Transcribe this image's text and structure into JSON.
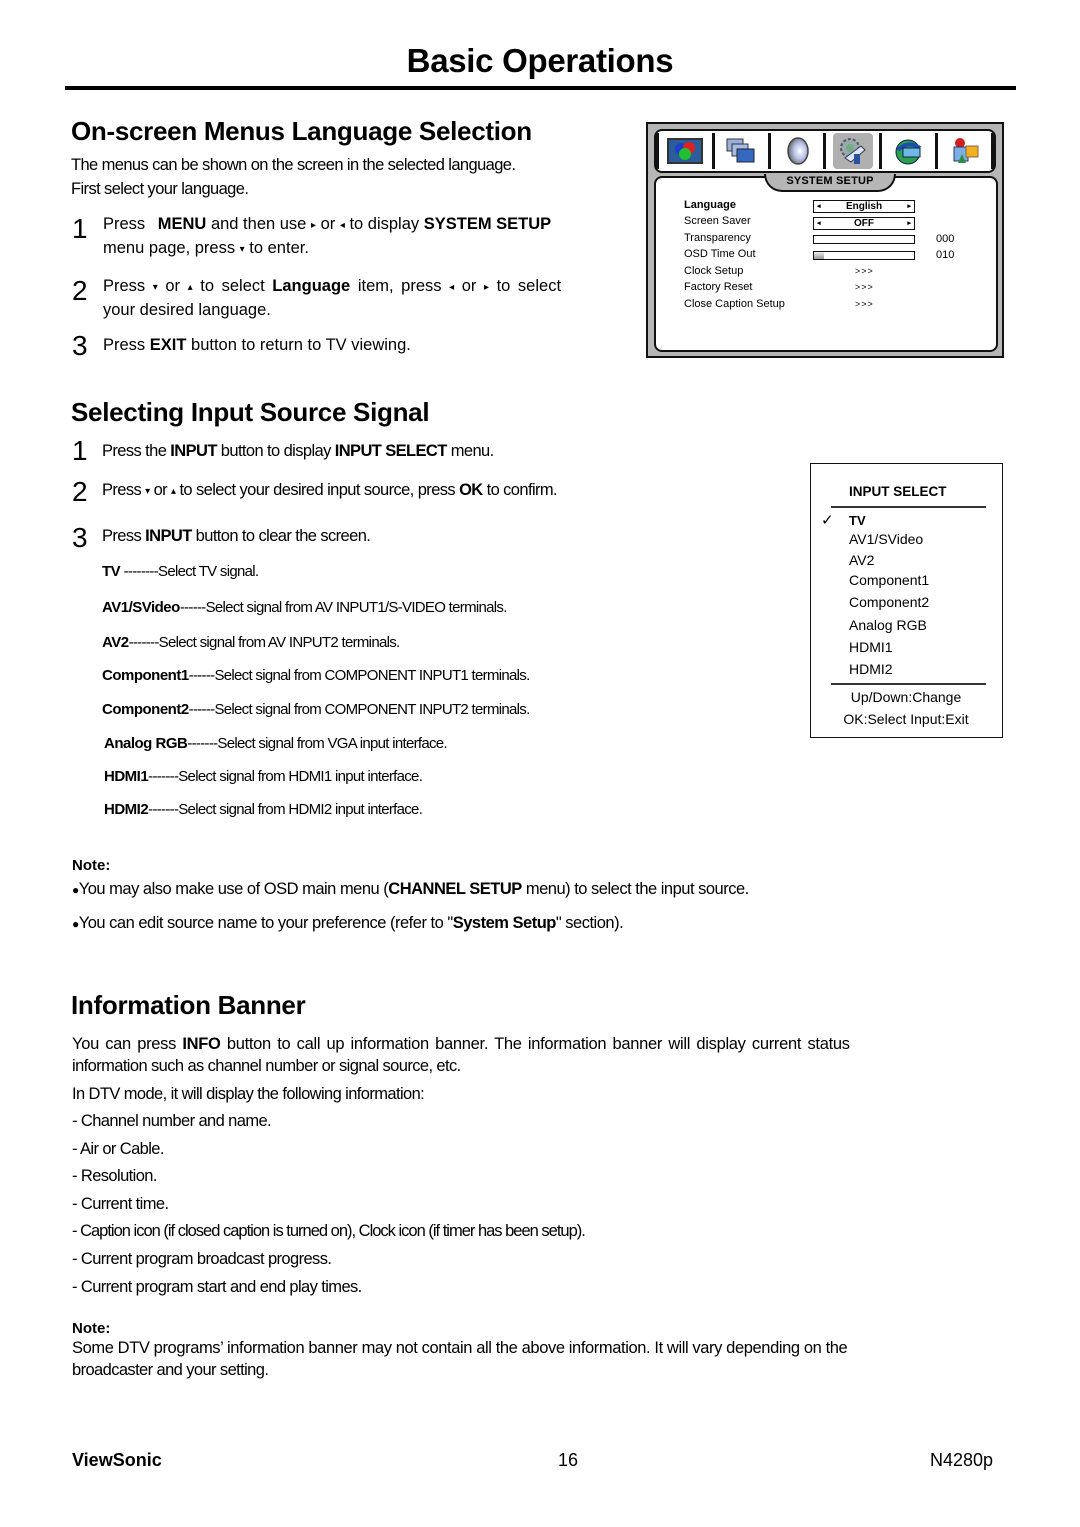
{
  "page": {
    "title": "Basic Operations",
    "footer": {
      "brand": "ViewSonic",
      "page_number": "16",
      "model": "N4280p"
    }
  },
  "language_section": {
    "heading": "On-screen Menus Language Selection",
    "intro_line1": "The menus can be shown on the screen in the selected language.",
    "intro_line2": "First select your language.",
    "steps": [
      {
        "num": "1",
        "parts": [
          "Press ",
          "MENU",
          " and then use ",
          "▸",
          " or ",
          "◂",
          " to display ",
          "SYSTEM SETUP"
        ],
        "line2_a": "menu page, press ",
        "line2_arrow": "▾",
        "line2_b": " to enter."
      },
      {
        "num": "2",
        "a": "Press ",
        "down": "▾",
        "b": " or ",
        "up": "▴",
        "c": " to select ",
        "bold": "Language",
        "d": " item, press ",
        "left": "◂",
        "e": " or ",
        "right": "▸",
        "f": " to select",
        "line2": "your desired language."
      },
      {
        "num": "3",
        "a": "Press ",
        "bold": "EXIT",
        "b": " button to return to TV viewing."
      }
    ]
  },
  "osd_system_setup": {
    "tabs": [
      {
        "name": "picture",
        "icon": "picture-icon"
      },
      {
        "name": "screen",
        "icon": "screen-windows-icon"
      },
      {
        "name": "audio",
        "icon": "speaker-icon"
      },
      {
        "name": "system-setup",
        "icon": "gear-tools-icon",
        "active": true
      },
      {
        "name": "channel",
        "icon": "globe-icon"
      },
      {
        "name": "parental",
        "icon": "blocks-icon"
      }
    ],
    "banner": "SYSTEM SETUP",
    "rows": [
      {
        "label": "Language",
        "type": "select",
        "value": "English",
        "bold": true
      },
      {
        "label": "Screen Saver",
        "type": "select",
        "value": "OFF"
      },
      {
        "label": "Transparency",
        "type": "bar",
        "value_text": "000",
        "fraction": 0.0
      },
      {
        "label": "OSD Time Out",
        "type": "bar",
        "value_text": "010",
        "fraction": 0.1
      },
      {
        "label": "Clock Setup",
        "type": "submenu",
        "value": ">>>"
      },
      {
        "label": "Factory Reset",
        "type": "submenu",
        "value": ">>>"
      },
      {
        "label": "Close Caption Setup",
        "type": "submenu",
        "value": ">>>"
      }
    ],
    "left_arrow": "◂",
    "right_arrow": "▸"
  },
  "input_section": {
    "heading": "Selecting Input Source Signal",
    "steps": [
      {
        "num": "1",
        "a": "Press the ",
        "b1": "INPUT",
        "c": " button to display ",
        "b2": "INPUT SELECT",
        "d": " menu."
      },
      {
        "num": "2",
        "a": "Press ",
        "down": "▾",
        "b": " or ",
        "up": "▴",
        "c": " to select your desired input source, press ",
        "bold": "OK",
        "d": " to confirm."
      },
      {
        "num": "3",
        "a": "Press ",
        "bold": "INPUT",
        "b": " button to clear the screen."
      }
    ],
    "signals": [
      {
        "name": "TV",
        "dashes": " --------",
        "desc": "Select TV signal."
      },
      {
        "name": "AV1/SVideo",
        "dashes": "------",
        "desc": "Select signal from AV INPUT1/S-VIDEO terminals."
      },
      {
        "name": "AV2",
        "dashes": "-------",
        "desc": "Select signal from AV INPUT2  terminals."
      },
      {
        "name": "Component1",
        "dashes": "------",
        "desc": "Select signal from COMPONENT INPUT1 terminals."
      },
      {
        "name": "Component2",
        "dashes": "------",
        "desc": "Select signal from COMPONENT INPUT2 terminals."
      },
      {
        "name": "Analog RGB",
        "dashes": "-------",
        "desc": "Select signal from VGA input interface."
      },
      {
        "name": "HDMI1",
        "dashes": "-------",
        "desc": "Select signal from HDMI1 input interface."
      },
      {
        "name": "HDMI2",
        "dashes": "-------",
        "desc": "Select signal from HDMI2 input interface."
      }
    ],
    "note_label": "Note:",
    "notes": [
      {
        "bullet": "●",
        "a": "You may also make use of OSD main menu (",
        "bold": "CHANNEL SETUP",
        "b": " menu) to select the input source."
      },
      {
        "bullet": "●",
        "a": "You can edit source name to your preference (refer to \"",
        "bold": "System Setup",
        "b": "\" section)."
      }
    ]
  },
  "input_select_menu": {
    "title": "INPUT SELECT",
    "check": "✓",
    "items": [
      "TV",
      "AV1/SVideo",
      "AV2",
      "Component1",
      "Component2",
      "Analog RGB",
      "HDMI1",
      "HDMI2"
    ],
    "selected": "TV",
    "footer_line1": "Up/Down:Change",
    "footer_line2": "OK:Select  Input:Exit"
  },
  "info_section": {
    "heading": "Information Banner",
    "para_a": "You can press ",
    "para_bold": "INFO",
    "para_b": " button to call up information banner. The information banner will display current status",
    "para_line2": "information such as channel number or signal source, etc.",
    "dtv_intro": "In DTV mode, it will display the following information:",
    "items": [
      "- Channel number and name.",
      "- Air or Cable.",
      "- Resolution.",
      "- Current time.",
      "- Caption icon (if closed caption is turned on), Clock icon (if timer has been setup).",
      "- Current program broadcast progress.",
      "- Current program start and end play times."
    ],
    "note_label": "Note:",
    "note_line1": "Some DTV programs’ information banner may not contain all the above information. It will vary depending on the",
    "note_line2": "broadcaster and your setting."
  }
}
